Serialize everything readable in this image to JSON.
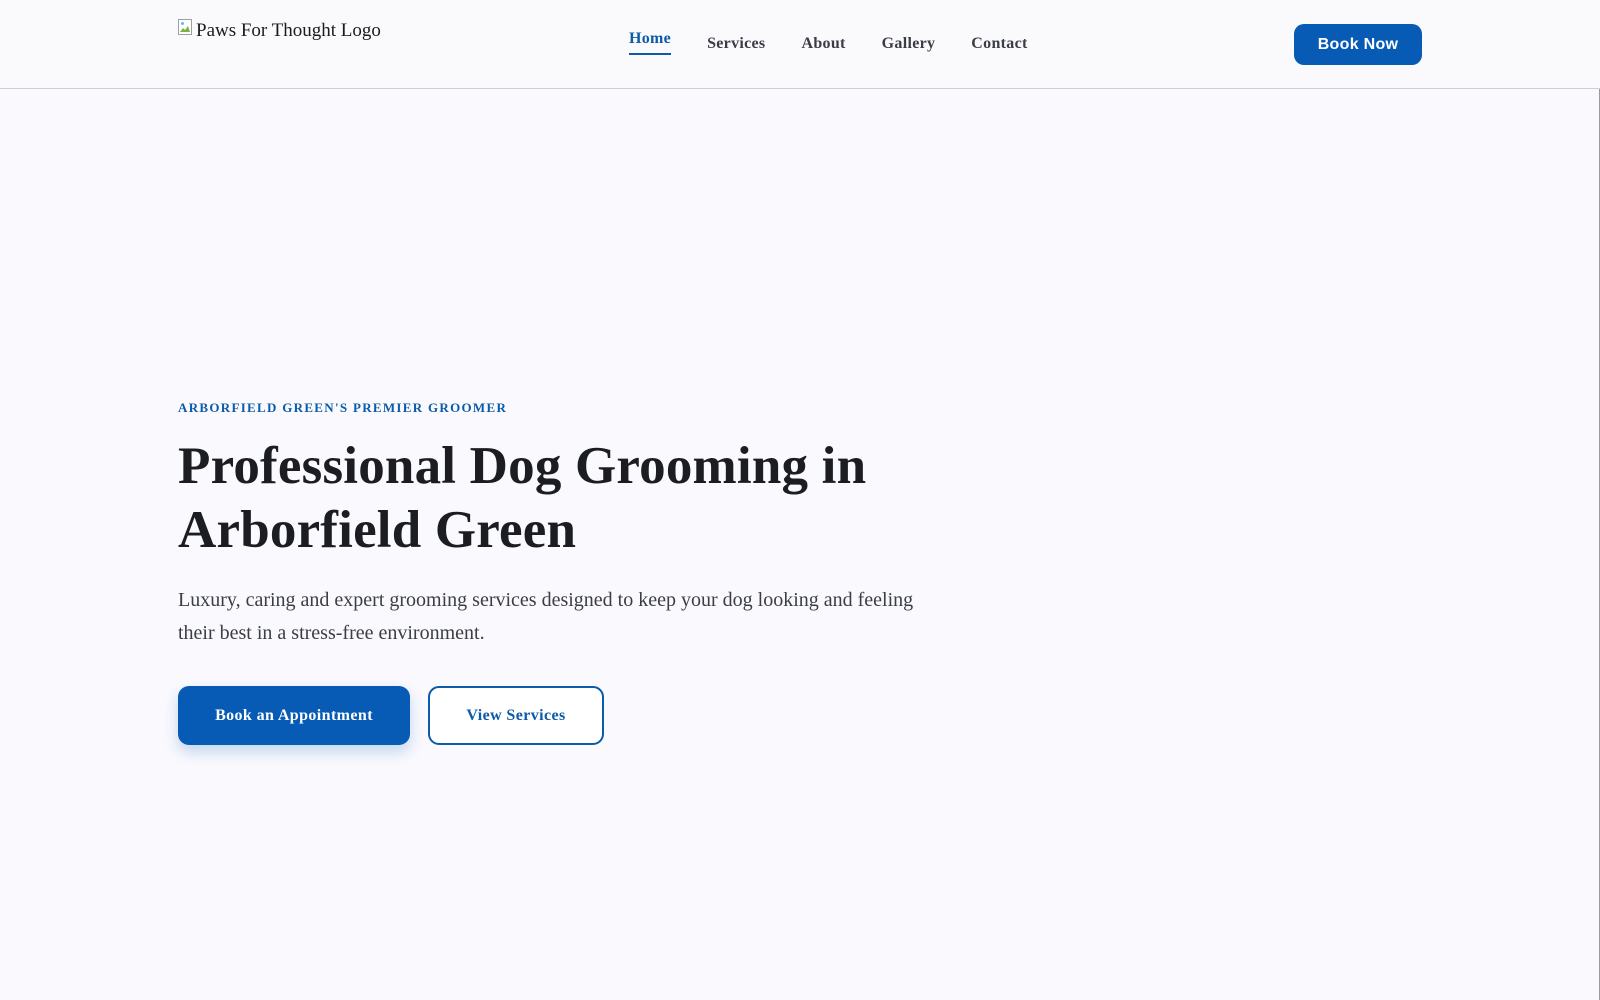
{
  "header": {
    "logo_alt": "Paws For Thought Logo",
    "nav": [
      {
        "label": "Home",
        "active": true
      },
      {
        "label": "Services",
        "active": false
      },
      {
        "label": "About",
        "active": false
      },
      {
        "label": "Gallery",
        "active": false
      },
      {
        "label": "Contact",
        "active": false
      }
    ],
    "cta_label": "Book Now"
  },
  "hero": {
    "eyebrow": "ARBORFIELD GREEN'S PREMIER GROOMER",
    "title_line1": "Professional Dog Grooming in",
    "title_line2": "Arborfield Green",
    "subtitle_line1": "Luxury, caring and expert grooming services designed to keep your dog looking and feeling",
    "subtitle_line2": "their best in a stress-free environment.",
    "primary_button": "Book an Appointment",
    "secondary_button": "View Services"
  },
  "colors": {
    "brand_blue": "#075bb5",
    "nav_active": "#0c5aa8",
    "heading": "#1b1d22",
    "background": "#f9f9fe"
  }
}
